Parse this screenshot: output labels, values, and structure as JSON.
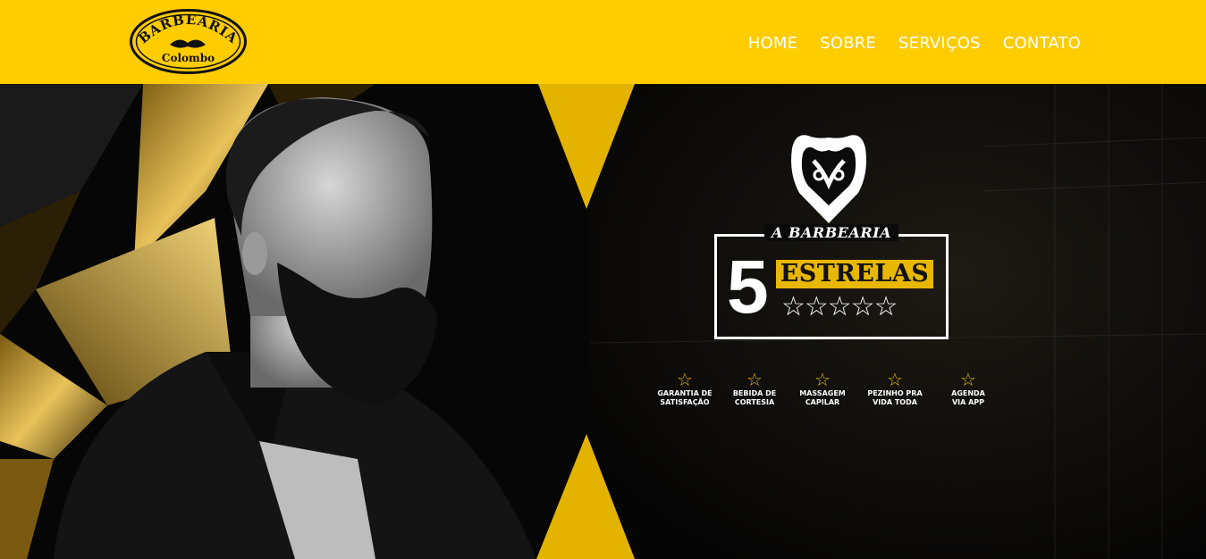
{
  "brand": {
    "name_line1": "BARBEARIA",
    "name_line2": "Colombo",
    "color_primary": "#ffcc00",
    "color_text": "#ffffff"
  },
  "nav": {
    "items": [
      {
        "label": "HOME"
      },
      {
        "label": "SOBRE"
      },
      {
        "label": "SERVIÇOS"
      },
      {
        "label": "CONTATO"
      }
    ]
  },
  "hero": {
    "badge_title": "A BARBEARIA",
    "badge_number": "5",
    "badge_word": "ESTRELAS",
    "badge_stars": "☆☆☆☆☆",
    "emblem_icon": "barber-shield-icon",
    "features": [
      {
        "icon": "star-icon",
        "label": "GARANTIA DE\nSATISFAÇÃO"
      },
      {
        "icon": "star-icon",
        "label": "BEBIDA DE\nCORTESIA"
      },
      {
        "icon": "star-icon",
        "label": "MASSAGEM\nCAPILAR"
      },
      {
        "icon": "star-icon",
        "label": "PEZINHO PRA\nVIDA TODA"
      },
      {
        "icon": "star-icon",
        "label": "AGENDA\nVIA APP"
      }
    ]
  }
}
